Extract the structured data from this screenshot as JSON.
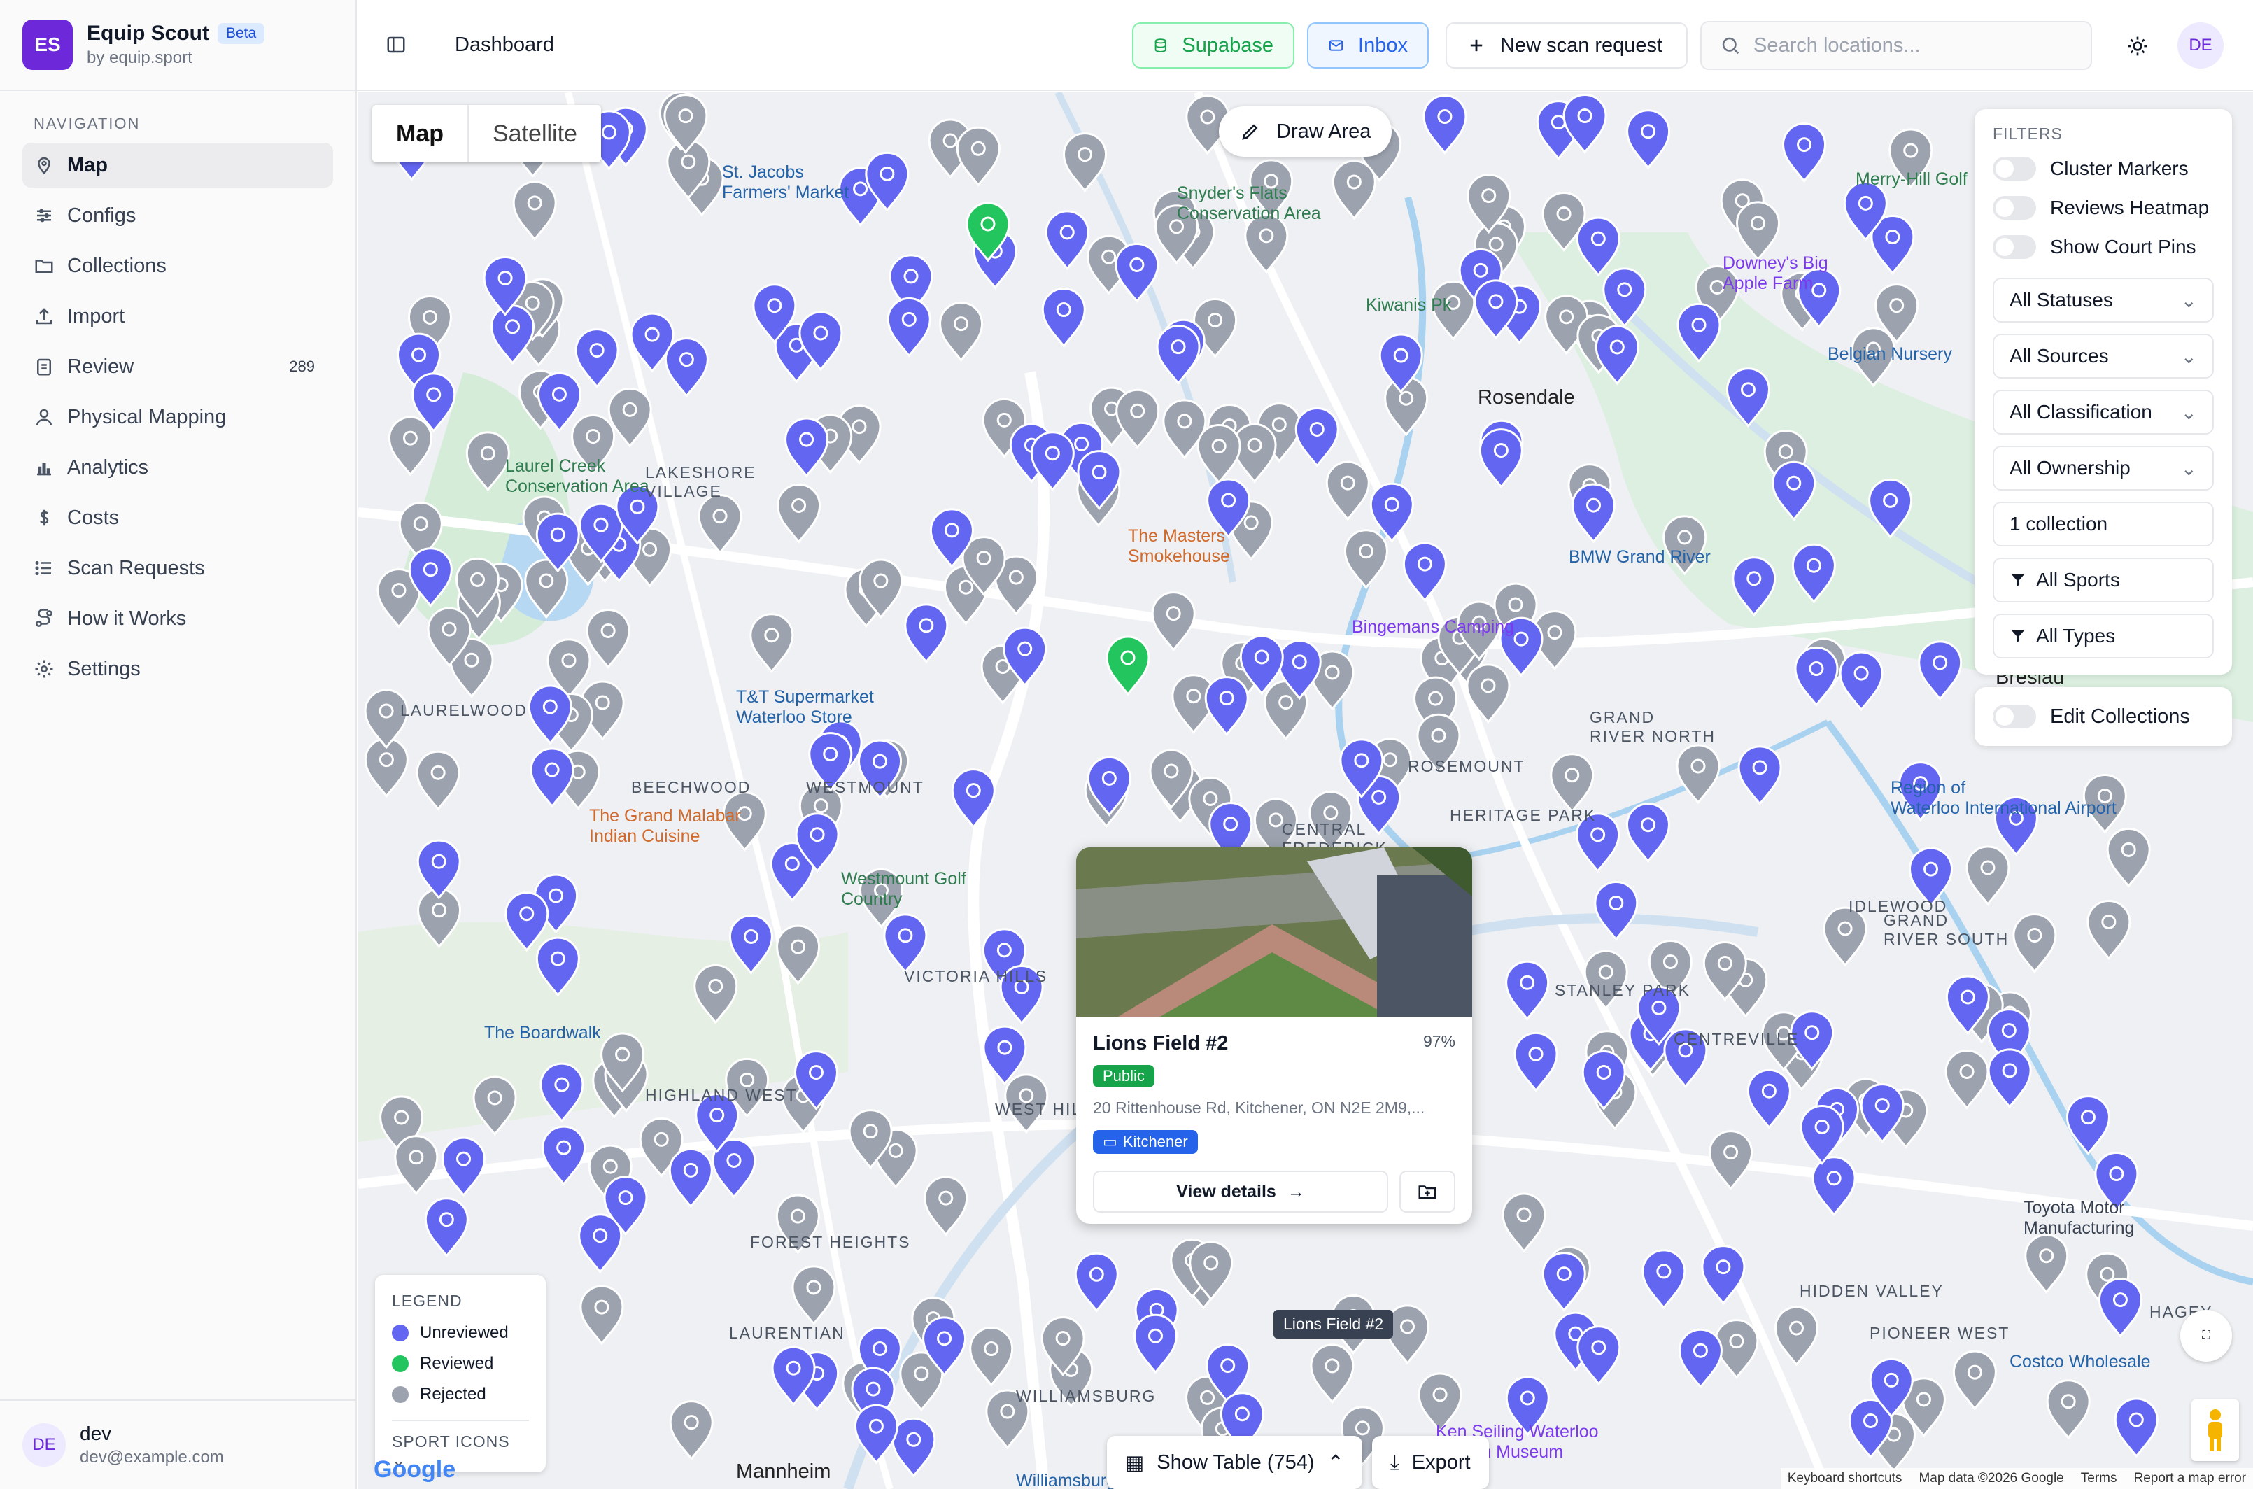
{
  "brand": {
    "initials": "ES",
    "name": "Equip Scout",
    "badge": "Beta",
    "subtitle": "by equip.sport"
  },
  "nav": {
    "heading": "NAVIGATION",
    "items": [
      {
        "label": "Map",
        "icon": "map-pin-icon",
        "active": true
      },
      {
        "label": "Configs",
        "icon": "sliders-icon"
      },
      {
        "label": "Collections",
        "icon": "folder-icon"
      },
      {
        "label": "Import",
        "icon": "upload-icon"
      },
      {
        "label": "Review",
        "icon": "clipboard-icon",
        "count": "289"
      },
      {
        "label": "Physical Mapping",
        "icon": "user-pin-icon"
      },
      {
        "label": "Analytics",
        "icon": "bar-chart-icon"
      },
      {
        "label": "Costs",
        "icon": "dollar-icon"
      },
      {
        "label": "Scan Requests",
        "icon": "list-icon"
      },
      {
        "label": "How it Works",
        "icon": "route-icon"
      },
      {
        "label": "Settings",
        "icon": "gear-icon"
      }
    ]
  },
  "user": {
    "initials": "DE",
    "name": "dev",
    "email": "dev@example.com"
  },
  "topbar": {
    "title": "Dashboard",
    "supabase": "Supabase",
    "inbox": "Inbox",
    "new_scan": "New scan request",
    "search_placeholder": "Search locations...",
    "avatar": "DE"
  },
  "map": {
    "type_map": "Map",
    "type_satellite": "Satellite",
    "draw_area": "Draw Area",
    "labels": [
      {
        "text": "St. Jacobs",
        "sub": "Farmers' Market",
        "cls": "blue"
      },
      {
        "text": "Snyder's Flats",
        "sub": "Conservation Area",
        "cls": "green"
      },
      {
        "text": "Kiwanis Pk",
        "cls": "green"
      },
      {
        "text": "Merry-Hill Golf",
        "cls": "green"
      },
      {
        "text": "Downey's Big",
        "sub": "Apple Farm",
        "cls": "purple"
      },
      {
        "text": "Belgian Nursery",
        "cls": "blue"
      },
      {
        "text": "Rosendale",
        "cls": "town"
      },
      {
        "text": "Laurel Creek",
        "sub": "Conservation Area",
        "cls": "green"
      },
      {
        "text": "LAKESHORE",
        "sub": "VILLAGE",
        "cls": "area"
      },
      {
        "text": "BMW Grand River",
        "cls": "blue"
      },
      {
        "text": "Bingemans Camping",
        "cls": "purple"
      },
      {
        "text": "Breslau",
        "cls": "town"
      },
      {
        "text": "The Boardwalk",
        "cls": "blue"
      },
      {
        "text": "Costco Wholesale",
        "cls": "blue"
      },
      {
        "text": "Region of",
        "sub": "Waterloo International Airport",
        "cls": "blue"
      },
      {
        "text": "Toyota Motor",
        "sub": "Manufacturing",
        "cls": ""
      },
      {
        "text": "WESTMOUNT",
        "cls": "area"
      },
      {
        "text": "BEECHWOOD",
        "cls": "area"
      },
      {
        "text": "LAURELWOOD",
        "cls": "area"
      },
      {
        "text": "ROSEMOUNT",
        "cls": "area"
      },
      {
        "text": "GRAND",
        "sub": "RIVER NORTH",
        "cls": "area"
      },
      {
        "text": "HERITAGE PARK",
        "cls": "area"
      },
      {
        "text": "IDLEWOOD",
        "cls": "area"
      },
      {
        "text": "GRAND",
        "sub": "RIVER SOUTH",
        "cls": "area"
      },
      {
        "text": "STANLEY PARK",
        "cls": "area"
      },
      {
        "text": "CENTREVILLE",
        "cls": "area"
      },
      {
        "text": "HIGHLAND WEST",
        "cls": "area"
      },
      {
        "text": "FOREST HEIGHTS",
        "cls": "area"
      },
      {
        "text": "LAURENTIAN",
        "cls": "area"
      },
      {
        "text": "WILLIAMSBURG",
        "cls": "area"
      },
      {
        "text": "HIDDEN VALLEY",
        "cls": "area"
      },
      {
        "text": "PIONEER WEST",
        "cls": "area"
      },
      {
        "text": "HAGEY",
        "cls": "area"
      },
      {
        "text": "Mannheim",
        "cls": "town"
      },
      {
        "text": "Ken Seiling Waterloo",
        "sub": "Region Museum",
        "cls": "purple"
      },
      {
        "text": "Westmount Golf",
        "sub": "Country",
        "cls": "green"
      },
      {
        "text": "T&T Supermarket",
        "sub": "Waterloo Store",
        "cls": "blue"
      },
      {
        "text": "The Grand Malabar",
        "sub": "Indian Cuisine",
        "cls": "orange"
      },
      {
        "text": "The Masters",
        "sub": "Smokehouse",
        "cls": "orange"
      },
      {
        "text": "Williamsburg",
        "cls": "blue"
      },
      {
        "text": "VICTORIA HILLS",
        "cls": "area"
      },
      {
        "text": "WEST HILL",
        "cls": "area"
      },
      {
        "text": "CENTRAL",
        "sub": "FREDERICK",
        "cls": "area"
      }
    ],
    "colors": {
      "unreviewed": "#6366f1",
      "reviewed": "#22c55e",
      "rejected": "#9ca3af"
    }
  },
  "filters": {
    "heading": "FILTERS",
    "toggles": [
      "Cluster Markers",
      "Reviews Heatmap",
      "Show Court Pins"
    ],
    "selects": [
      "All Statuses",
      "All Sources",
      "All Classification",
      "All Ownership"
    ],
    "collection": "1 collection",
    "sports": "All Sports",
    "types": "All Types",
    "edit_collections": "Edit Collections"
  },
  "legend": {
    "heading": "LEGEND",
    "items": [
      {
        "label": "Unreviewed",
        "color": "#6366f1"
      },
      {
        "label": "Reviewed",
        "color": "#22c55e"
      },
      {
        "label": "Rejected",
        "color": "#9ca3af"
      }
    ],
    "sport_icons": "SPORT ICONS"
  },
  "card": {
    "title": "Lions Field #2",
    "score": "97%",
    "badge": "Public",
    "address": "20 Rittenhouse Rd, Kitchener, ON N2E 2M9,...",
    "tag": "Kitchener",
    "view_details": "View details"
  },
  "tooltip": "Lions Field #2",
  "bottom": {
    "show_table": "Show Table (754)",
    "export": "Export"
  },
  "attribution": {
    "keyboard": "Keyboard shortcuts",
    "mapdata": "Map data ©2026 Google",
    "terms": "Terms",
    "report": "Report a map error"
  },
  "google": "Google"
}
